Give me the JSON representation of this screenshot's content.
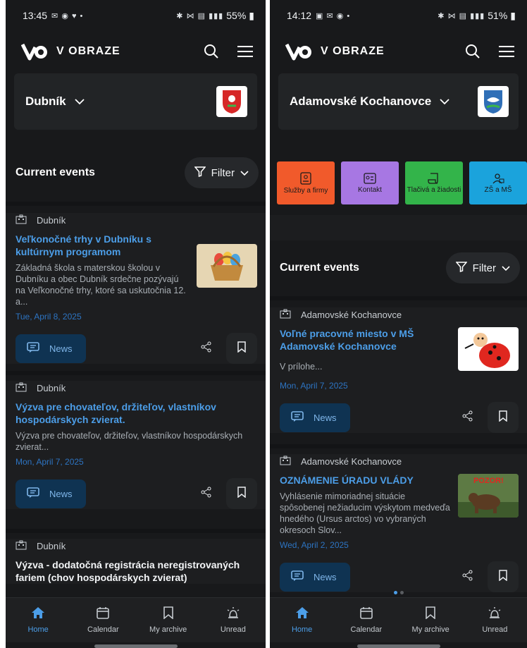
{
  "screens": [
    {
      "status": {
        "time": "13:45",
        "battery": "55%"
      },
      "app": {
        "brand": "V OBRAZE"
      },
      "municipality": {
        "name": "Dubník"
      },
      "section": {
        "title": "Current events",
        "filter_label": "Filter"
      },
      "events": [
        {
          "source": "Dubník",
          "title": "Veľkonočné trhy v Dubníku s kultúrnym programom",
          "body": "Základná škola s materskou školou v Dubníku a obec Dubník srdečne pozývajú na Veľkonočné trhy, ktoré sa uskutočnia 12. a...",
          "date": "Tue, April 8, 2025",
          "tag": "News"
        },
        {
          "source": "Dubník",
          "title": "Výzva pre chovateľov, držiteľov, vlastníkov hospodárskych zvierat.",
          "body": "Výzva pre chovateľov, držiteľov, vlastníkov hospodárskych zvierat...",
          "date": "Mon, April 7, 2025",
          "tag": "News"
        },
        {
          "source": "Dubník",
          "title": "Výzva - dodatočná registrácia neregistrovaných fariem (chov hospodárskych zvierat)"
        }
      ],
      "nav": [
        "Home",
        "Calendar",
        "My archive",
        "Unread"
      ]
    },
    {
      "status": {
        "time": "14:12",
        "battery": "51%"
      },
      "app": {
        "brand": "V OBRAZE"
      },
      "municipality": {
        "name": "Adamovské Kochanovce"
      },
      "tiles": [
        {
          "label": "Služby a firmy",
          "color": "#f15a2b"
        },
        {
          "label": "Kontakt",
          "color": "#a777e3"
        },
        {
          "label": "Tlačivá a žiadosti",
          "color": "#33b44a"
        },
        {
          "label": "ZŠ a MŠ",
          "color": "#1ba3dc"
        }
      ],
      "section": {
        "title": "Current events",
        "filter_label": "Filter"
      },
      "events": [
        {
          "source": "Adamovské Kochanovce",
          "title": "Voľné pracovné miesto v MŠ Adamovské Kochanovce",
          "body": "V prílohe...",
          "date": "Mon, April 7, 2025",
          "tag": "News"
        },
        {
          "source": "Adamovské Kochanovce",
          "title": "OZNÁMENIE ÚRADU VLÁDY",
          "body": "Vyhlásenie mimoriadnej situácie spôsobenej nežiaducim výskytom medveďa hnedého (Ursus arctos) vo vybraných okresoch Slov...",
          "date": "Wed, April 2, 2025",
          "tag": "News",
          "thumb_text": "POZOR!"
        }
      ],
      "nav": [
        "Home",
        "Calendar",
        "My archive",
        "Unread"
      ]
    }
  ],
  "colors": {
    "accent": "#4c9ee8",
    "background": "#18191b",
    "date": "#2d74c2",
    "news_chip": "#0f3352"
  },
  "icons": [
    "search-icon",
    "menu-icon",
    "chevron-down-icon",
    "filter-icon",
    "building-icon",
    "news-icon",
    "share-icon",
    "bookmark-icon",
    "home-icon",
    "calendar-icon",
    "alarm-icon"
  ]
}
